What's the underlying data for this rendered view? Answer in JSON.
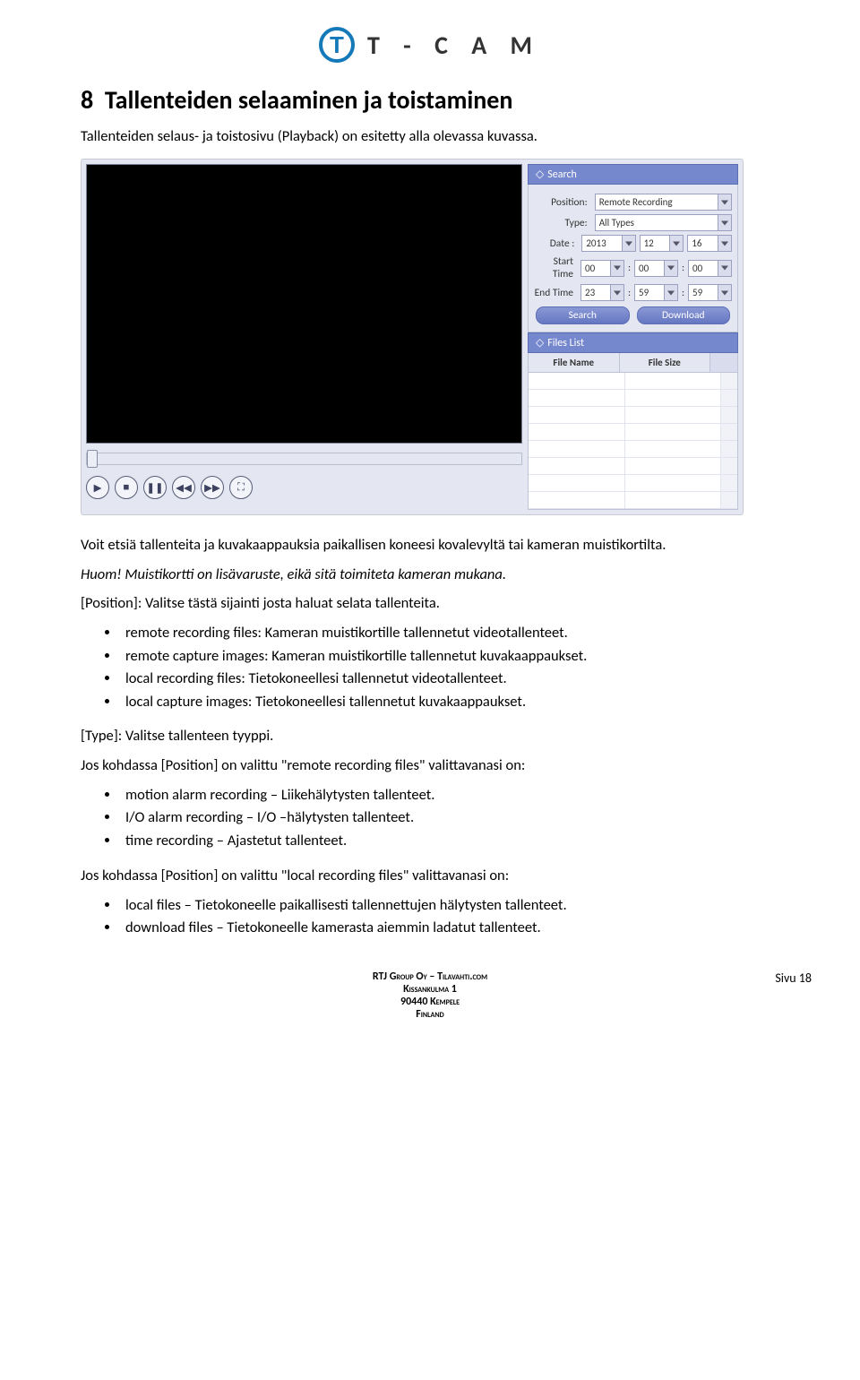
{
  "logo_text": "T - C A M",
  "heading_number": "8",
  "heading": "Tallenteiden selaaminen ja toistaminen",
  "intro": "Tallenteiden selaus- ja toistosivu (Playback) on esitetty alla olevassa kuvassa.",
  "after_image": "Voit etsiä tallenteita ja kuvakaappauksia paikallisen koneesi kovalevyltä tai kameran muistikortilta.",
  "note": "Huom! Muistikortti on lisävaruste, eikä sitä toimiteta kameran mukana.",
  "position_para": "[Position]: Valitse tästä sijainti josta haluat selata tallenteita.",
  "bullets1": [
    "remote recording files: Kameran muistikortille tallennetut videotallenteet.",
    "remote capture images: Kameran muistikortille tallennetut kuvakaappaukset.",
    "local recording files: Tietokoneellesi tallennetut videotallenteet.",
    "local capture images: Tietokoneellesi tallennetut kuvakaappaukset."
  ],
  "type_para": "[Type]: Valitse tallenteen tyyppi.",
  "remote_sel_para": "Jos kohdassa [Position] on valittu \"remote recording files\" valittavanasi on:",
  "bullets2": [
    "motion alarm recording – Liikehälytysten tallenteet.",
    "I/O alarm recording – I/O –hälytysten tallenteet.",
    "time recording – Ajastetut tallenteet."
  ],
  "local_sel_para": "Jos kohdassa [Position] on valittu \"local recording files\" valittavanasi on:",
  "bullets3": [
    "local files – Tietokoneelle paikallisesti tallennettujen hälytysten tallenteet.",
    "download files – Tietokoneelle kamerasta aiemmin ladatut tallenteet."
  ],
  "search_panel": {
    "title": "Search",
    "rows": {
      "position_label": "Position:",
      "position_value": "Remote Recording",
      "type_label": "Type:",
      "type_value": "All Types",
      "date_label": "Date :",
      "date_y": "2013",
      "date_m": "12",
      "date_d": "16",
      "start_label": "Start Time",
      "start_h": "00",
      "start_m": "00",
      "start_s": "00",
      "end_label": "End Time",
      "end_h": "23",
      "end_m": "59",
      "end_s": "59",
      "colon": ":"
    },
    "buttons": {
      "search": "Search",
      "download": "Download"
    }
  },
  "files_panel": {
    "title": "Files List",
    "cols": {
      "name": "File Name",
      "size": "File Size"
    }
  },
  "footer": {
    "l1": "RTJ Group Oy – Tilavahti.com",
    "l2": "Kissankulma 1",
    "l3": "90440 Kempele",
    "l4": "Finland",
    "page": "Sivu 18"
  }
}
